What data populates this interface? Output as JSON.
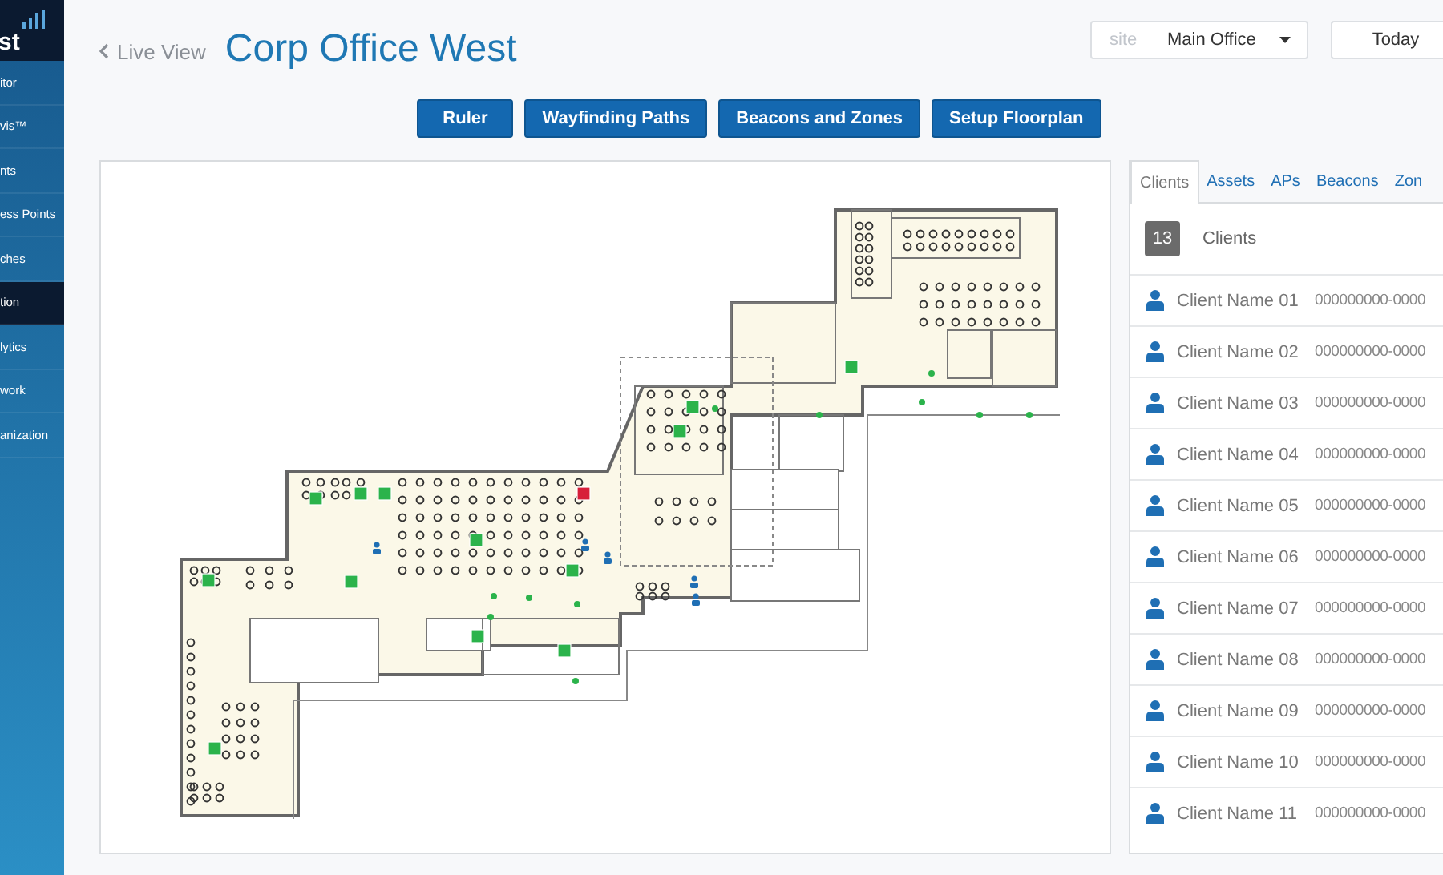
{
  "sidebar": {
    "logo": "st",
    "items": [
      {
        "label": "itor",
        "selected": false
      },
      {
        "label": "vis™",
        "selected": false
      },
      {
        "label": "nts",
        "selected": false
      },
      {
        "label": "ess Points",
        "selected": false
      },
      {
        "label": "ches",
        "selected": false
      },
      {
        "label": "tion",
        "selected": true
      },
      {
        "label": "lytics",
        "selected": false
      },
      {
        "label": "work",
        "selected": false
      },
      {
        "label": "anization",
        "selected": false
      }
    ]
  },
  "header": {
    "back_link": "Live View",
    "title": "Corp Office West",
    "site_selector": {
      "label": "site",
      "value": "Main Office"
    },
    "date_button": "Today"
  },
  "toolbar": {
    "buttons": [
      "Ruler",
      "Wayfinding Paths",
      "Beacons and Zones",
      "Setup Floorplan"
    ]
  },
  "side_panel": {
    "tabs": [
      {
        "label": "Clients",
        "selected": true
      },
      {
        "label": "Assets",
        "selected": false
      },
      {
        "label": "APs",
        "selected": false
      },
      {
        "label": "Beacons",
        "selected": false
      },
      {
        "label": "Zon",
        "selected": false
      }
    ],
    "count": "13",
    "count_label": "Clients",
    "clients": [
      {
        "name": "Client Name 01",
        "id": "000000000-0000"
      },
      {
        "name": "Client Name 02",
        "id": "000000000-0000"
      },
      {
        "name": "Client Name 03",
        "id": "000000000-0000"
      },
      {
        "name": "Client Name 04",
        "id": "000000000-0000"
      },
      {
        "name": "Client Name 05",
        "id": "000000000-0000"
      },
      {
        "name": "Client Name 06",
        "id": "000000000-0000"
      },
      {
        "name": "Client Name 07",
        "id": "000000000-0000"
      },
      {
        "name": "Client Name 08",
        "id": "000000000-0000"
      },
      {
        "name": "Client Name 09",
        "id": "000000000-0000"
      },
      {
        "name": "Client Name 10",
        "id": "000000000-0000"
      },
      {
        "name": "Client Name 11",
        "id": "000000000-0000"
      }
    ]
  }
}
